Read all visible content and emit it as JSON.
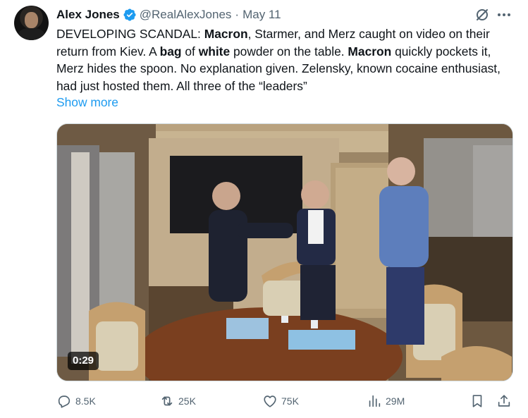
{
  "author": {
    "name": "Alex Jones",
    "handle": "@RealAlexJones",
    "separator": "·",
    "date": "May 11"
  },
  "tweet": {
    "segments": [
      {
        "text": "DEVELOPING SCANDAL: ",
        "bold": false
      },
      {
        "text": "Macron",
        "bold": true
      },
      {
        "text": ", Starmer, and Merz caught on video on their return from Kiev. A ",
        "bold": false
      },
      {
        "text": "bag",
        "bold": true
      },
      {
        "text": " of ",
        "bold": false
      },
      {
        "text": "white",
        "bold": true
      },
      {
        "text": " powder on the table. ",
        "bold": false
      },
      {
        "text": "Macron",
        "bold": true
      },
      {
        "text": " quickly pockets it, Merz hides the spoon. No explanation given. Zelensky, known cocaine enthusiast, had just hosted them. All three of the “leaders”",
        "bold": false
      }
    ],
    "show_more": "Show more"
  },
  "media": {
    "duration": "0:29"
  },
  "actions": {
    "replies": "8.5K",
    "reposts": "25K",
    "likes": "75K",
    "views": "29M"
  },
  "icons": [
    "verified-badge-icon",
    "grok-icon",
    "more-icon",
    "reply-icon",
    "repost-icon",
    "like-icon",
    "views-icon",
    "bookmark-icon",
    "share-icon"
  ],
  "colors": {
    "accent": "#1d9bf0",
    "secondary_text": "#536471",
    "primary_text": "#0f1419"
  }
}
